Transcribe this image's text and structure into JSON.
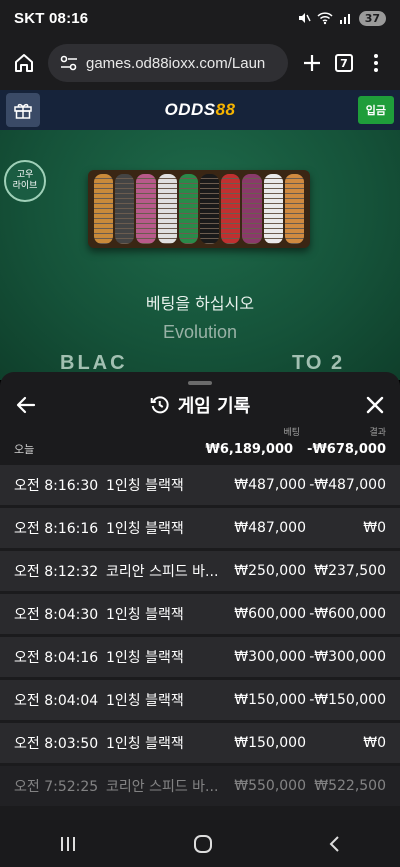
{
  "status": {
    "carrier": "SKT",
    "time": "08:16",
    "battery": "37"
  },
  "browser": {
    "url": "games.od88ioxx.com/Laun",
    "tab_count": "7"
  },
  "site": {
    "logo_text": "ODDS",
    "logo_num": "88",
    "deposit_label": "입금"
  },
  "game": {
    "live_badge": "고우\n라이브",
    "bet_prompt": "베팅을 하십시오",
    "brand": "Evolution",
    "arc_left": "BLAC",
    "arc_right": "TO 2"
  },
  "history": {
    "title": "게임 기록",
    "col_bet": "베팅",
    "col_result": "결과",
    "day_label": "오늘",
    "total_bet": "₩6,189,000",
    "total_result": "-₩678,000",
    "rows": [
      {
        "time": "오전 8:16:30",
        "game": "1인칭 블랙잭",
        "bet": "₩487,000",
        "result": "-₩487,000"
      },
      {
        "time": "오전 8:16:16",
        "game": "1인칭 블랙잭",
        "bet": "₩487,000",
        "result": "₩0"
      },
      {
        "time": "오전 8:12:32",
        "game": "코리안 스피드 바...",
        "bet": "₩250,000",
        "result": "₩237,500"
      },
      {
        "time": "오전 8:04:30",
        "game": "1인칭 블랙잭",
        "bet": "₩600,000",
        "result": "-₩600,000"
      },
      {
        "time": "오전 8:04:16",
        "game": "1인칭 블랙잭",
        "bet": "₩300,000",
        "result": "-₩300,000"
      },
      {
        "time": "오전 8:04:04",
        "game": "1인칭 블랙잭",
        "bet": "₩150,000",
        "result": "-₩150,000"
      },
      {
        "time": "오전 8:03:50",
        "game": "1인칭 블랙잭",
        "bet": "₩150,000",
        "result": "₩0"
      },
      {
        "time": "오전 7:52:25",
        "game": "코리안 스피드 바...",
        "bet": "₩550,000",
        "result": "₩522,500"
      }
    ]
  },
  "colors": {
    "chips": [
      "#c98a3a",
      "#444444",
      "#b85a8a",
      "#e0e0e0",
      "#2a8a4a",
      "#1a1a1a",
      "#c03030",
      "#8a3a6a",
      "#eaeaea",
      "#d08a40"
    ]
  }
}
